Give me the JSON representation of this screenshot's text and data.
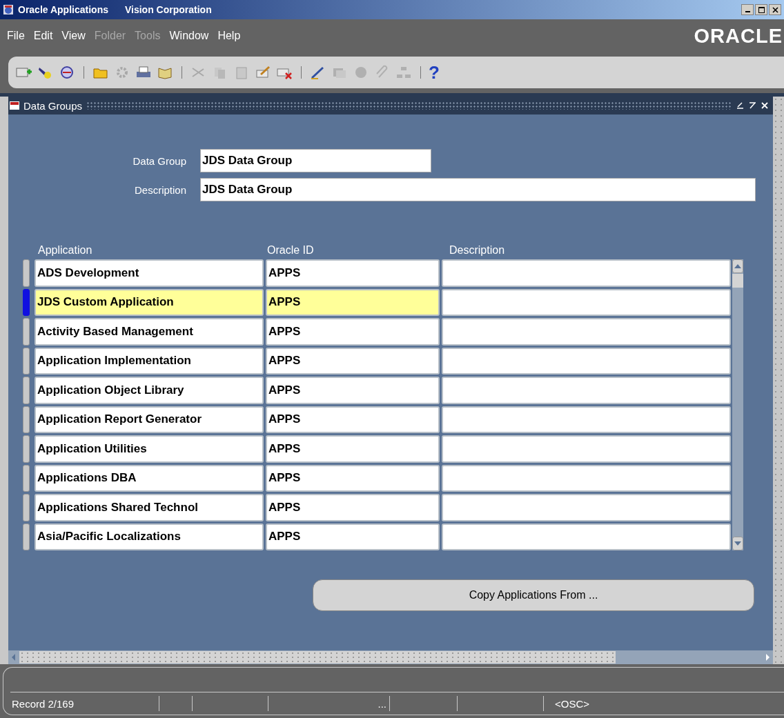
{
  "window": {
    "title": "Oracle Applications",
    "subtitle": "Vision Corporation"
  },
  "menu": [
    {
      "label": "File",
      "disabled": false
    },
    {
      "label": "Edit",
      "disabled": false
    },
    {
      "label": "View",
      "disabled": false
    },
    {
      "label": "Folder",
      "disabled": true
    },
    {
      "label": "Tools",
      "disabled": true
    },
    {
      "label": "Window",
      "disabled": false
    },
    {
      "label": "Help",
      "disabled": false
    }
  ],
  "logo": "ORACLE",
  "toolbar": {
    "help": "?"
  },
  "form": {
    "title": "Data Groups",
    "fields": [
      {
        "label": "Data Group",
        "value": "JDS Data Group",
        "kind": "short"
      },
      {
        "label": "Description",
        "value": "JDS Data Group",
        "kind": "wide"
      }
    ],
    "table": {
      "columns": [
        "Application",
        "Oracle ID",
        "Description"
      ],
      "rows": [
        {
          "application": "ADS Development",
          "oracle_id": "APPS",
          "selected": false
        },
        {
          "application": "JDS Custom Application",
          "oracle_id": "APPS",
          "selected": true
        },
        {
          "application": "Activity Based Management",
          "oracle_id": "APPS",
          "selected": false
        },
        {
          "application": "Application Implementation",
          "oracle_id": "APPS",
          "selected": false
        },
        {
          "application": "Application Object Library",
          "oracle_id": "APPS",
          "selected": false
        },
        {
          "application": "Application Report Generator",
          "oracle_id": "APPS",
          "selected": false
        },
        {
          "application": "Application Utilities",
          "oracle_id": "APPS",
          "selected": false
        },
        {
          "application": "Applications DBA",
          "oracle_id": "APPS",
          "selected": false
        },
        {
          "application": "Applications Shared Technol",
          "oracle_id": "APPS",
          "selected": false
        },
        {
          "application": "Asia/Pacific Localizations",
          "oracle_id": "APPS",
          "selected": false
        }
      ]
    },
    "button": "Copy Applications From ..."
  },
  "status_bar": {
    "record": "Record 2/169",
    "segments": [
      "...",
      "<OSC>"
    ]
  }
}
